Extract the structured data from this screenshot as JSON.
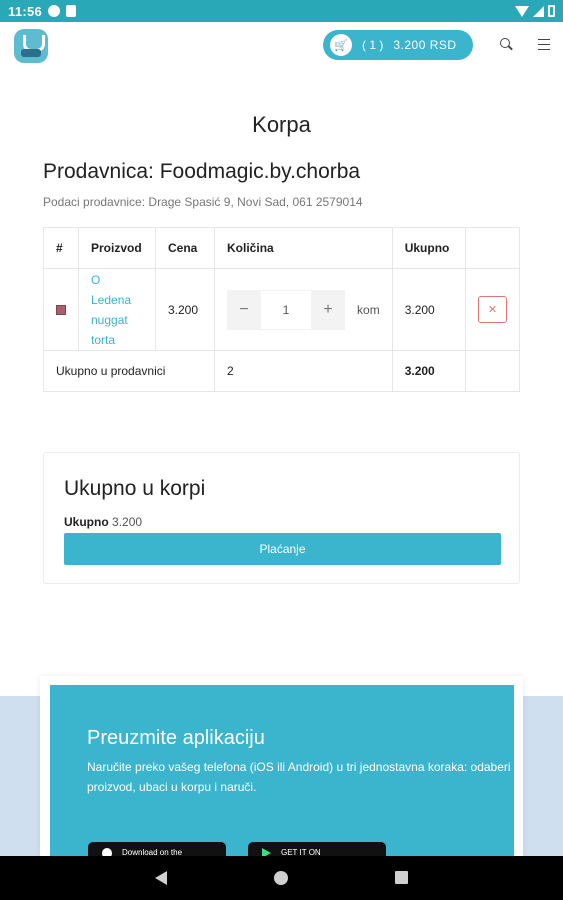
{
  "status_bar": {
    "time": "11:56"
  },
  "header": {
    "cart_count": "( 1 )",
    "cart_total": "3.200 RSD"
  },
  "page": {
    "title": "Korpa",
    "shop_title": "Prodavnica: Foodmagic.by.chorba",
    "shop_info": "Podaci prodavnice: Drage Spasić 9, Novi Sad, 061 2579014"
  },
  "table": {
    "headers": [
      "#",
      "Proizvod",
      "Cena",
      "Količina",
      "Ukupno",
      ""
    ],
    "items": [
      {
        "product": "O Ledena nuggat torta",
        "price": "3.200",
        "qty_minus": "−",
        "quantity": "1",
        "qty_plus": "+",
        "unit": "kom",
        "total": "3.200",
        "remove": "✕"
      }
    ],
    "total_row": {
      "label": "Ukupno u prodavnici",
      "quantity": "2",
      "total": "3.200"
    }
  },
  "summary": {
    "title": "Ukupno u korpi",
    "total_label": "Ukupno",
    "total_value": "3.200",
    "checkout_label": "Plaćanje"
  },
  "promo": {
    "title": "Preuzmite aplikaciju",
    "text": "Naručite preko vašeg telefona (iOS ili Android) u tri jednostavna koraka: odaberi proizvod, ubaci u korpu i naruči.",
    "apple_label": "Download on the",
    "google_label": "GET IT ON"
  },
  "colors": {
    "accent": "#3bb4cd",
    "status_bar": "#29a8b8",
    "danger": "#e57373"
  }
}
